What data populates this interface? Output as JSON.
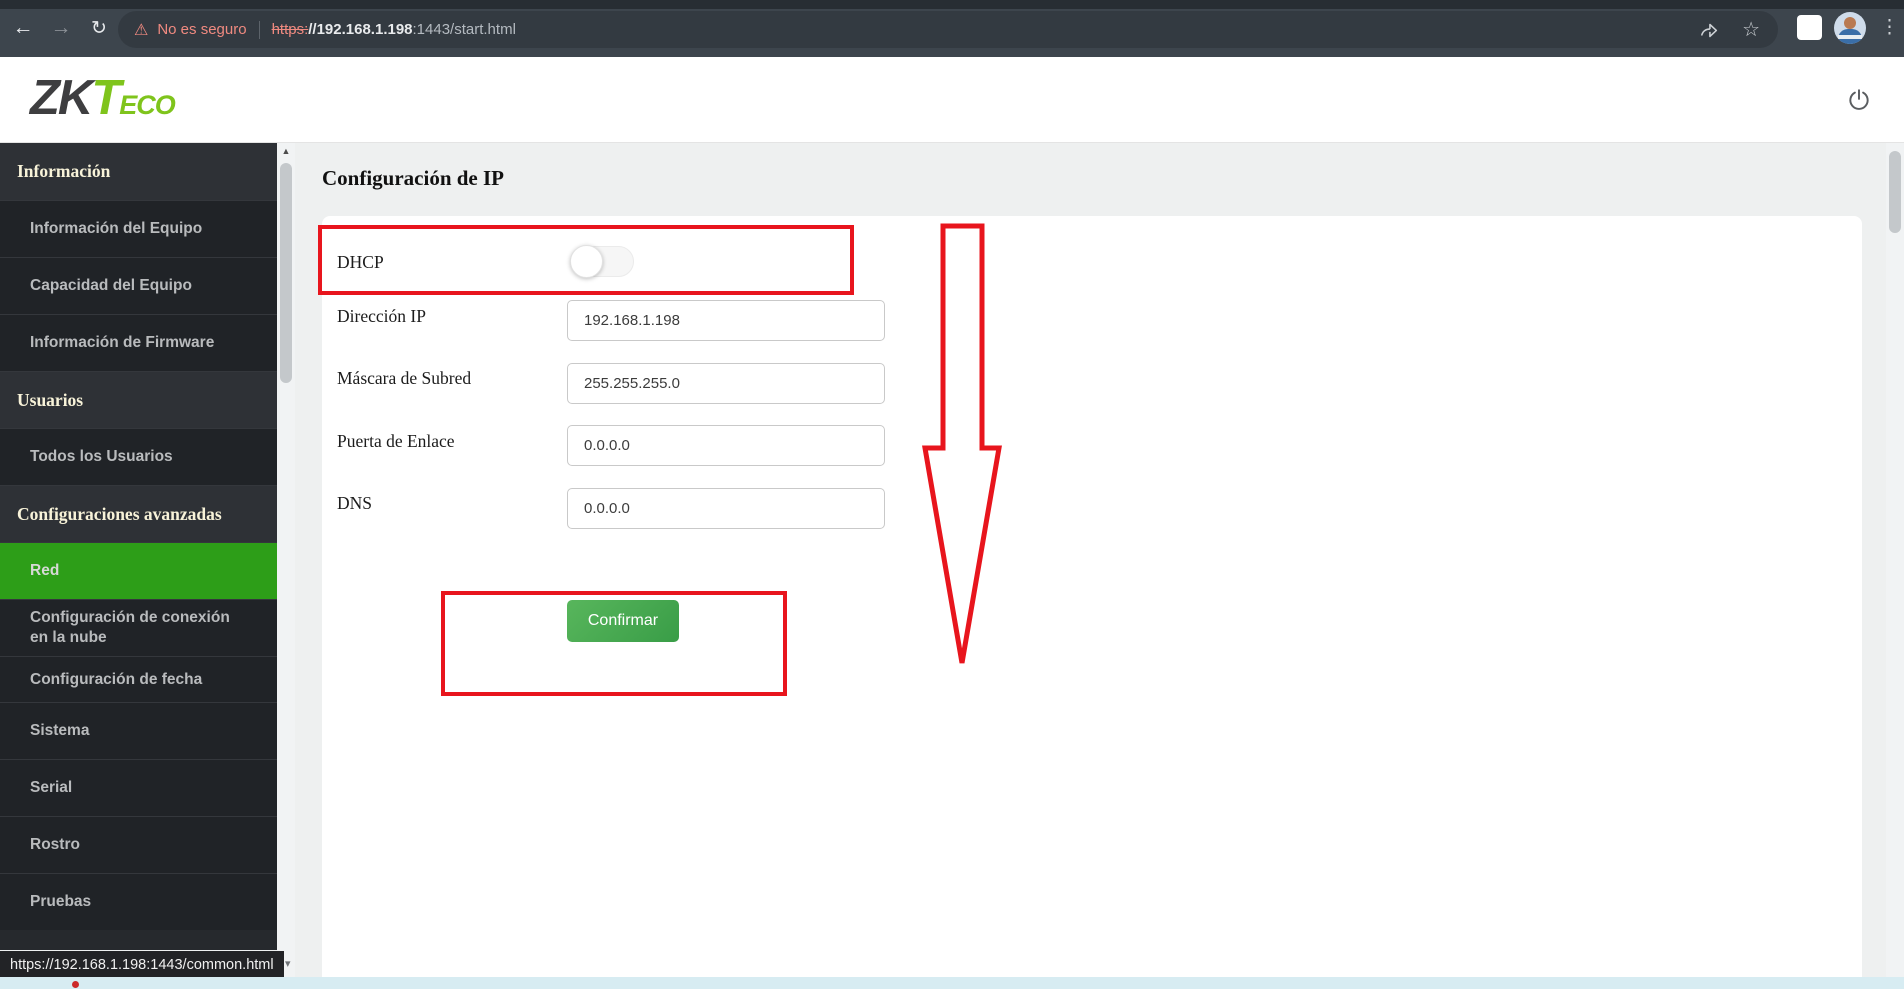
{
  "browser": {
    "security_chip": "No es seguro",
    "url": {
      "scheme_struck": "https:",
      "host": "//192.168.1.198",
      "rest": ":1443/start.html"
    },
    "link_preview": "https://192.168.1.198:1443/common.html"
  },
  "header": {
    "logo": {
      "zk": "ZK",
      "t": "T",
      "eco": "ECO"
    }
  },
  "sidebar": {
    "items": [
      {
        "variant": "section",
        "label": "Información"
      },
      {
        "variant": "item",
        "label": "Información del Equipo"
      },
      {
        "variant": "item",
        "label": "Capacidad del Equipo"
      },
      {
        "variant": "item",
        "label": "Información de Firmware"
      },
      {
        "variant": "section",
        "label": "Usuarios"
      },
      {
        "variant": "item",
        "label": "Todos los Usuarios"
      },
      {
        "variant": "section",
        "label": "Configuraciones avanzadas"
      },
      {
        "variant": "item-selected",
        "label": "Red"
      },
      {
        "variant": "item",
        "label": "Configuración de conexión en la nube"
      },
      {
        "variant": "item",
        "label": "Configuración de fecha",
        "short": true
      },
      {
        "variant": "item",
        "label": "Sistema"
      },
      {
        "variant": "item",
        "label": "Serial"
      },
      {
        "variant": "item",
        "label": "Rostro"
      },
      {
        "variant": "item",
        "label": "Pruebas"
      }
    ]
  },
  "main": {
    "title": "Configuración de IP",
    "form": {
      "dhcp": {
        "label": "DHCP",
        "state": "off"
      },
      "fields": [
        {
          "label": "Dirección IP",
          "value": "192.168.1.198"
        },
        {
          "label": "Máscara de Subred",
          "value": "255.255.255.0"
        },
        {
          "label": "Puerta de Enlace",
          "value": "0.0.0.0"
        },
        {
          "label": "DNS",
          "value": "0.0.0.0"
        }
      ],
      "confirm_label": "Confirmar"
    }
  },
  "colors": {
    "logo_green": "#7fc41c",
    "selected_green": "#2d9e18",
    "annotation_red": "#e8151d",
    "warning_salmon": "#f08a80",
    "confirm_gradient_start": "#58b65c",
    "confirm_gradient_end": "#399d47"
  }
}
